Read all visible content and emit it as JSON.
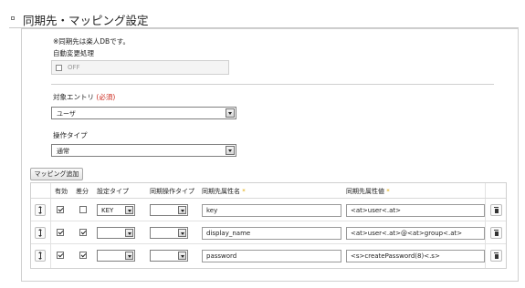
{
  "section": {
    "title": "同期先・マッピング設定"
  },
  "form": {
    "note": "※同期先は楽人DBです。",
    "auto_change": {
      "label": "自動変更処理",
      "value": "OFF"
    },
    "target_entry": {
      "label": "対象エントリ",
      "required": "(必須)",
      "value": "ユーザ"
    },
    "operation_type": {
      "label": "操作タイプ",
      "value": "通常"
    }
  },
  "mapping": {
    "add_label": "マッピング追加",
    "headers": {
      "enabled": "有効",
      "diff": "差分",
      "setting_type": "設定タイプ",
      "sync_op_type": "同期操作タイプ",
      "attr_name": "同期先属性名",
      "attr_value": "同期先属性値",
      "required_mark": "*"
    },
    "rows": [
      {
        "enabled": true,
        "diff": false,
        "setting_type": "KEY",
        "sync_op_type": "",
        "attr_name": "key",
        "attr_value": "<at>user<.at>"
      },
      {
        "enabled": true,
        "diff": true,
        "setting_type": "",
        "sync_op_type": "",
        "attr_name": "display_name",
        "attr_value": "<at>user<.at>@<at>group<.at>"
      },
      {
        "enabled": true,
        "diff": true,
        "setting_type": "",
        "sync_op_type": "",
        "attr_name": "password",
        "attr_value": "<s>createPassword(8)<.s>"
      }
    ]
  }
}
